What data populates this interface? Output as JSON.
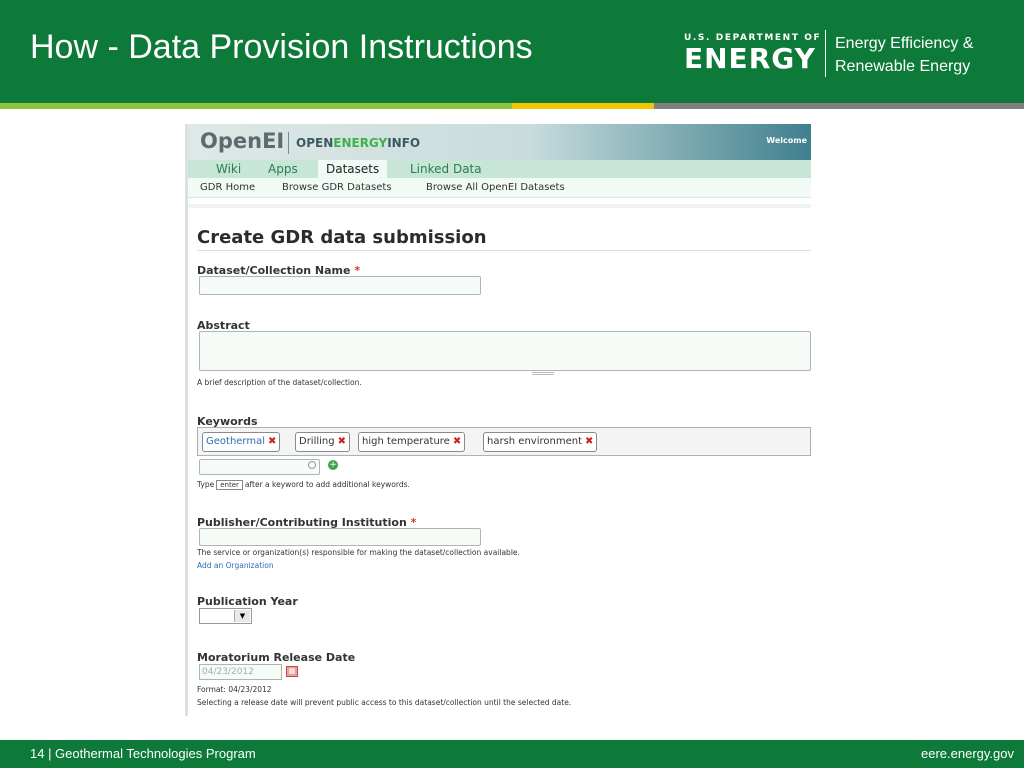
{
  "slide": {
    "title": "How - Data Provision Instructions",
    "doe_small": "U.S. DEPARTMENT OF",
    "doe_big": "ENERGY",
    "eere_line1": "Energy Efficiency &",
    "eere_line2": "Renewable Energy"
  },
  "screenshot": {
    "logo": "OpenEI",
    "openinfo_prefix": "OPEN",
    "openinfo_energy": "ENERGY",
    "openinfo_suffix": "INFO",
    "welcome": "Welcome",
    "tabs": [
      "Wiki",
      "Apps",
      "Datasets",
      "Linked Data"
    ],
    "active_tab": "Datasets",
    "sublinks": [
      "GDR Home",
      "Browse GDR Datasets",
      "Browse All OpenEI Datasets"
    ],
    "page_title": "Create GDR data submission",
    "fields": {
      "dataset_name_label": "Dataset/Collection Name",
      "abstract_label": "Abstract",
      "abstract_help": "A brief description of the dataset/collection.",
      "keywords_label": "Keywords",
      "keywords": [
        "Geothermal",
        "Drilling",
        "high temperature",
        "harsh environment"
      ],
      "keyword_help_pre": "Type",
      "keyword_help_key": "enter",
      "keyword_help_post": "after a keyword to add additional keywords.",
      "publisher_label": "Publisher/Contributing Institution",
      "publisher_help": "The service or organization(s) responsible for making the dataset/collection available.",
      "add_org_link": "Add an Organization",
      "pub_year_label": "Publication Year",
      "moratorium_label": "Moratorium Release Date",
      "moratorium_value": "04/23/2012",
      "moratorium_format": "Format: 04/23/2012",
      "moratorium_help": "Selecting a release date will prevent public access to this dataset/collection until the selected date.",
      "required_mark": "*"
    }
  },
  "footer": {
    "left": "14 | Geothermal Technologies Program",
    "right": "eere.energy.gov"
  },
  "colors": {
    "header_green": "#0d7a3a",
    "accent_green": "#8cc63f",
    "accent_yellow": "#f2c500",
    "accent_gray": "#808080"
  }
}
